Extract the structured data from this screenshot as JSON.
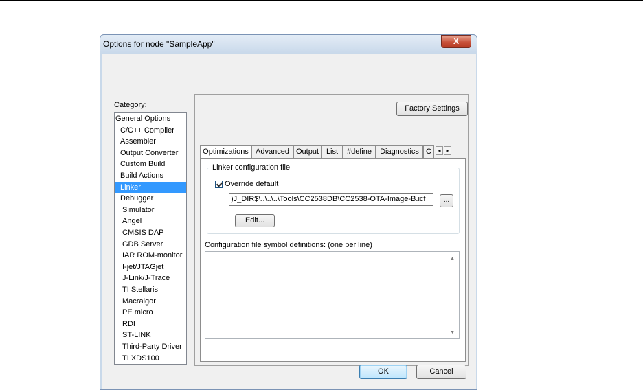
{
  "window": {
    "title": "Options for node \"SampleApp\"",
    "close_label": "X"
  },
  "category": {
    "label": "Category:",
    "items": [
      {
        "label": "General Options",
        "indent": 0
      },
      {
        "label": "C/C++ Compiler",
        "indent": 1
      },
      {
        "label": "Assembler",
        "indent": 1
      },
      {
        "label": "Output Converter",
        "indent": 1
      },
      {
        "label": "Custom Build",
        "indent": 1
      },
      {
        "label": "Build Actions",
        "indent": 1
      },
      {
        "label": "Linker",
        "indent": 1,
        "selected": true
      },
      {
        "label": "Debugger",
        "indent": 1
      },
      {
        "label": "Simulator",
        "indent": 2
      },
      {
        "label": "Angel",
        "indent": 2
      },
      {
        "label": "CMSIS DAP",
        "indent": 2
      },
      {
        "label": "GDB Server",
        "indent": 2
      },
      {
        "label": "IAR ROM-monitor",
        "indent": 2
      },
      {
        "label": "I-jet/JTAGjet",
        "indent": 2
      },
      {
        "label": "J-Link/J-Trace",
        "indent": 2
      },
      {
        "label": "TI Stellaris",
        "indent": 2
      },
      {
        "label": "Macraigor",
        "indent": 2
      },
      {
        "label": "PE micro",
        "indent": 2
      },
      {
        "label": "RDI",
        "indent": 2
      },
      {
        "label": "ST-LINK",
        "indent": 2
      },
      {
        "label": "Third-Party Driver",
        "indent": 2
      },
      {
        "label": "TI XDS100",
        "indent": 2
      }
    ]
  },
  "factory_settings_label": "Factory Settings",
  "tabs": [
    {
      "label": "Optimizations",
      "active": true
    },
    {
      "label": "Advanced"
    },
    {
      "label": "Output"
    },
    {
      "label": "List"
    },
    {
      "label": "#define"
    },
    {
      "label": "Diagnostics"
    },
    {
      "label": "C"
    }
  ],
  "tab_scroll": {
    "left": "◂",
    "right": "▸"
  },
  "linker": {
    "group_title": "Linker configuration file",
    "override_label": "Override default",
    "override_checked": true,
    "config_path": ")J_DIR$\\..\\..\\..\\Tools\\CC2538DB\\CC2538-OTA-Image-B.icf",
    "browse_label": "...",
    "edit_label": "Edit...",
    "symdef_label": "Configuration file symbol definitions: (one per line)",
    "symdef_value": ""
  },
  "buttons": {
    "ok": "OK",
    "cancel": "Cancel"
  },
  "colors": {
    "selection": "#3399ff",
    "titlebar": "#c8d8ea",
    "close": "#c8513a"
  }
}
